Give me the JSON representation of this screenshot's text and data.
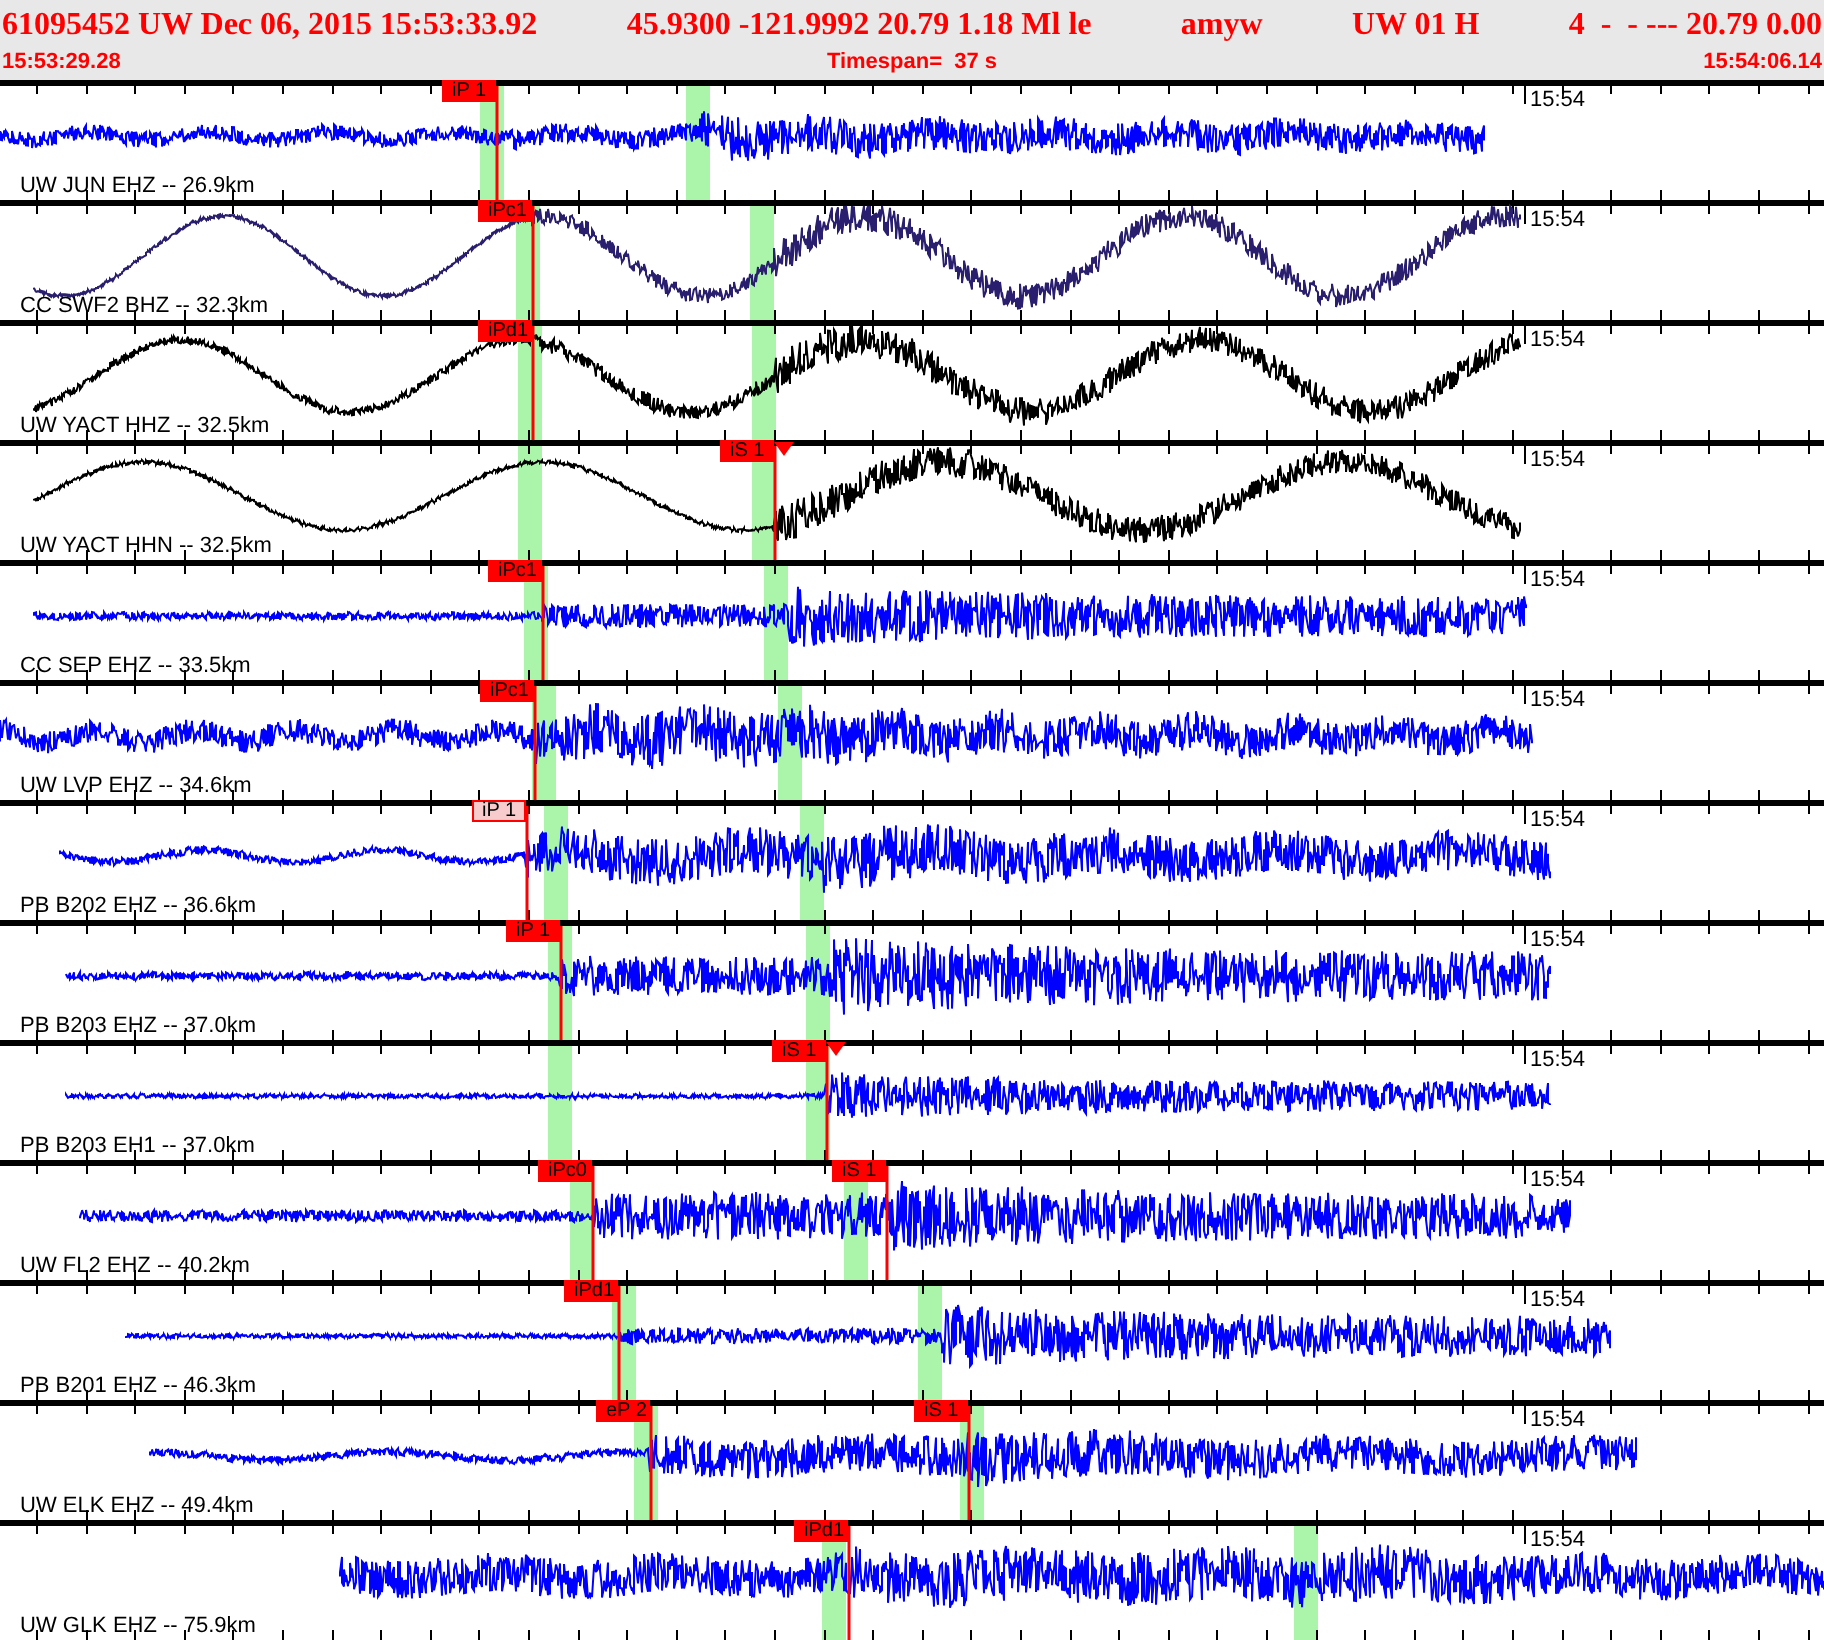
{
  "header": {
    "fields": [
      "61095452 UW Dec 06, 2015 15:53:33.92",
      "45.9300 -121.9992 20.79 1.18 Ml le",
      "amyw",
      "UW 01 H",
      "4  -  - --- 20.79 0.00"
    ]
  },
  "subheader": {
    "start": "15:53:29.28",
    "timespan": "Timespan=  37 s",
    "end": "15:54:06.14"
  },
  "traces": [
    {
      "label": "UW JUN EHZ -- 26.9km",
      "time": "15:54",
      "color": "#0000ff",
      "picks": [
        {
          "label": "iP 1",
          "faded": false,
          "flagged": false
        }
      ]
    },
    {
      "label": "CC SWF2 BHZ -- 32.3km",
      "time": "15:54",
      "color": "#2a1f6e",
      "picks": [
        {
          "label": "iPc1",
          "faded": false,
          "flagged": false
        }
      ]
    },
    {
      "label": "UW YACT HHZ -- 32.5km",
      "time": "15:54",
      "color": "#000000",
      "picks": [
        {
          "label": "iPd1",
          "faded": false,
          "flagged": false
        }
      ]
    },
    {
      "label": "UW YACT HHN -- 32.5km",
      "time": "15:54",
      "color": "#000000",
      "picks": [
        {
          "label": "iS 1",
          "faded": false,
          "flagged": true
        }
      ]
    },
    {
      "label": "CC SEP EHZ -- 33.5km",
      "time": "15:54",
      "color": "#0000ff",
      "picks": [
        {
          "label": "iPc1",
          "faded": false,
          "flagged": false
        }
      ]
    },
    {
      "label": "UW LVP EHZ -- 34.6km",
      "time": "15:54",
      "color": "#0000ff",
      "picks": [
        {
          "label": "iPc1",
          "faded": false,
          "flagged": false
        }
      ]
    },
    {
      "label": "PB B202 EHZ -- 36.6km",
      "time": "15:54",
      "color": "#0000ff",
      "picks": [
        {
          "label": "iP 1",
          "faded": true,
          "flagged": false
        }
      ]
    },
    {
      "label": "PB B203 EHZ -- 37.0km",
      "time": "15:54",
      "color": "#0000ff",
      "picks": [
        {
          "label": "iP 1",
          "faded": false,
          "flagged": false
        }
      ]
    },
    {
      "label": "PB B203 EH1 -- 37.0km",
      "time": "15:54",
      "color": "#0000ff",
      "picks": [
        {
          "label": "iS 1",
          "faded": false,
          "flagged": true
        }
      ]
    },
    {
      "label": "UW FL2 EHZ -- 40.2km",
      "time": "15:54",
      "color": "#0000ff",
      "picks": [
        {
          "label": "iPc0",
          "faded": false,
          "flagged": false
        },
        {
          "label": "iS 1",
          "faded": false,
          "flagged": false
        }
      ]
    },
    {
      "label": "PB B201 EHZ -- 46.3km",
      "time": "15:54",
      "color": "#0000ff",
      "picks": [
        {
          "label": "iPd1",
          "faded": false,
          "flagged": false
        }
      ]
    },
    {
      "label": "UW ELK EHZ -- 49.4km",
      "time": "15:54",
      "color": "#0000ff",
      "picks": [
        {
          "label": "eP 2",
          "faded": false,
          "flagged": false
        },
        {
          "label": "iS 1",
          "faded": false,
          "flagged": false
        }
      ]
    },
    {
      "label": "UW GLK EHZ -- 75.9km",
      "time": "15:54",
      "color": "#0000ff",
      "picks": [
        {
          "label": "iPd1",
          "faded": false,
          "flagged": false
        }
      ]
    }
  ]
}
